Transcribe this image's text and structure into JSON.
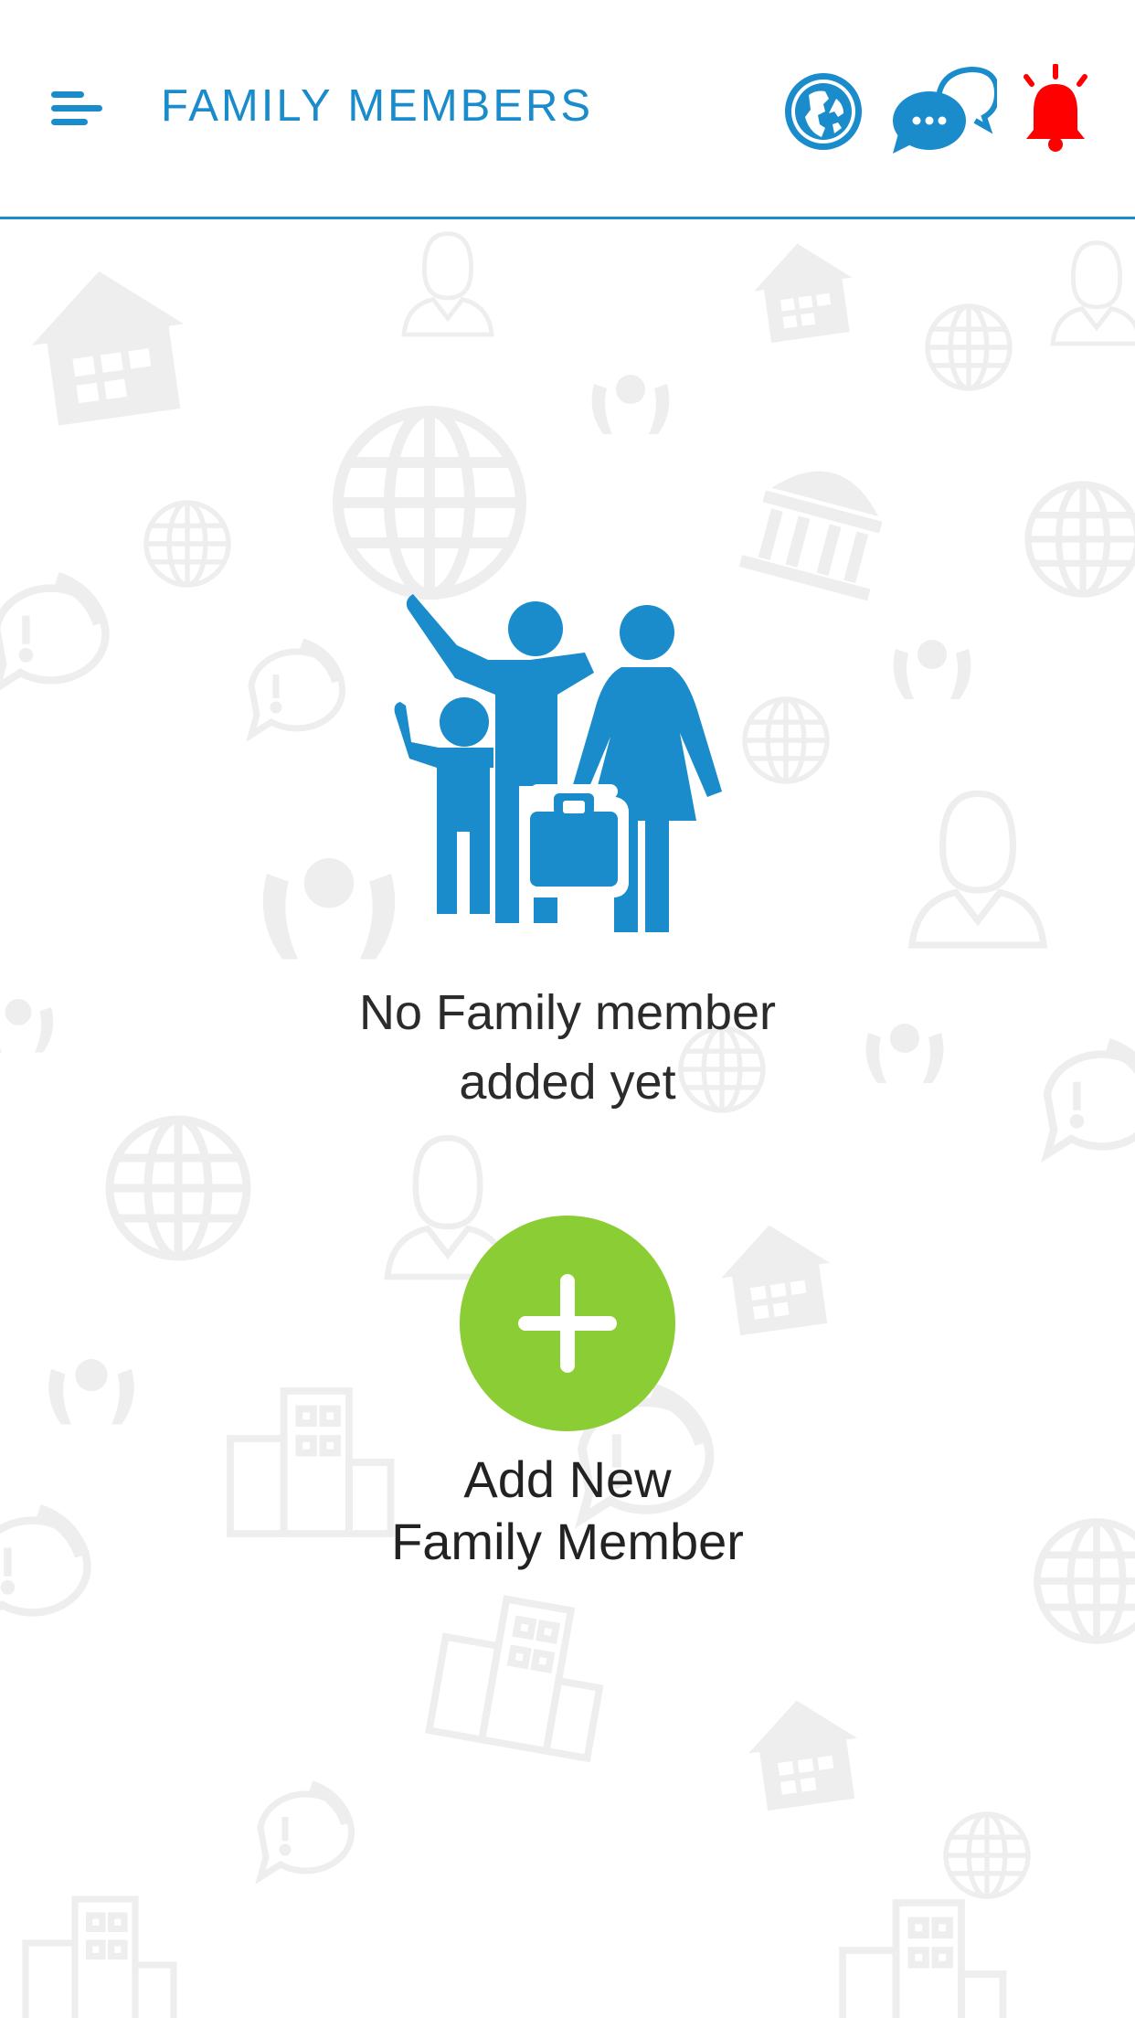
{
  "header": {
    "title": "FAMILY MEMBERS",
    "menu_icon": "hamburger-menu-icon",
    "actions": [
      {
        "name": "globe-icon",
        "color": "#1a8bcb"
      },
      {
        "name": "chat-bubbles-icon",
        "color": "#1a8bcb"
      },
      {
        "name": "alert-bell-icon",
        "color": "#ff0000"
      }
    ]
  },
  "empty_state": {
    "icon": "family-travel-icon",
    "message_line1": "No Family member",
    "message_line2": "added yet"
  },
  "add_member": {
    "icon": "plus-icon",
    "label_line1": "Add New",
    "label_line2": "Family Member"
  },
  "colors": {
    "primary": "#1a8bcb",
    "add_button": "#8bcd34",
    "alert": "#ff0000",
    "background_pattern": "#ededed"
  }
}
